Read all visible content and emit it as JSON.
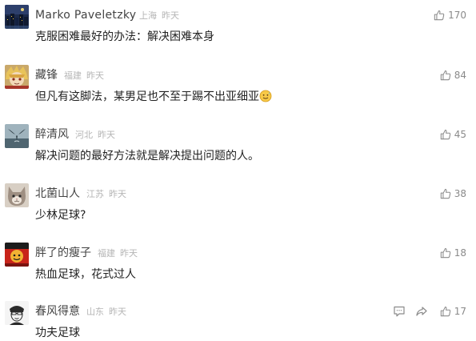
{
  "comments": [
    {
      "name": "Marko Paveletzky",
      "location": "上海",
      "time": "昨天",
      "text": "克服困难最好的办法：解决困难本身",
      "likes": "170",
      "avatar_icon": "night-city-avatar"
    },
    {
      "name": "藏锋",
      "location": "福建",
      "time": "昨天",
      "text": "但凡有这脚法，某男足也不至于踢不出亚细亚",
      "emoji": "sweat-smile-emoji",
      "likes": "84",
      "avatar_icon": "anime-character-avatar"
    },
    {
      "name": "醉清风",
      "location": "河北",
      "time": "昨天",
      "text": "解决问题的最好方法就是解决提出问题的人。",
      "likes": "45",
      "avatar_icon": "whale-tail-avatar"
    },
    {
      "name": "北菌山人",
      "location": "江苏",
      "time": "昨天",
      "text": "少林足球?",
      "likes": "38",
      "avatar_icon": "cat-avatar"
    },
    {
      "name": "胖了的瘦子",
      "location": "福建",
      "time": "昨天",
      "text": "热血足球，花式过人",
      "likes": "18",
      "avatar_icon": "red-cartoon-avatar"
    },
    {
      "name": "春风得意",
      "location": "山东",
      "time": "昨天",
      "text": "功夫足球",
      "likes": "17",
      "avatar_icon": "sketch-face-avatar",
      "has_reply_icon": true
    }
  ],
  "icons": {
    "like": "thumbs-up-icon",
    "reply": "comment-bubble-icon"
  },
  "colors": {
    "name": "#444444",
    "meta": "#b5b5b5",
    "text": "#222222",
    "like": "#8a8a8a"
  }
}
